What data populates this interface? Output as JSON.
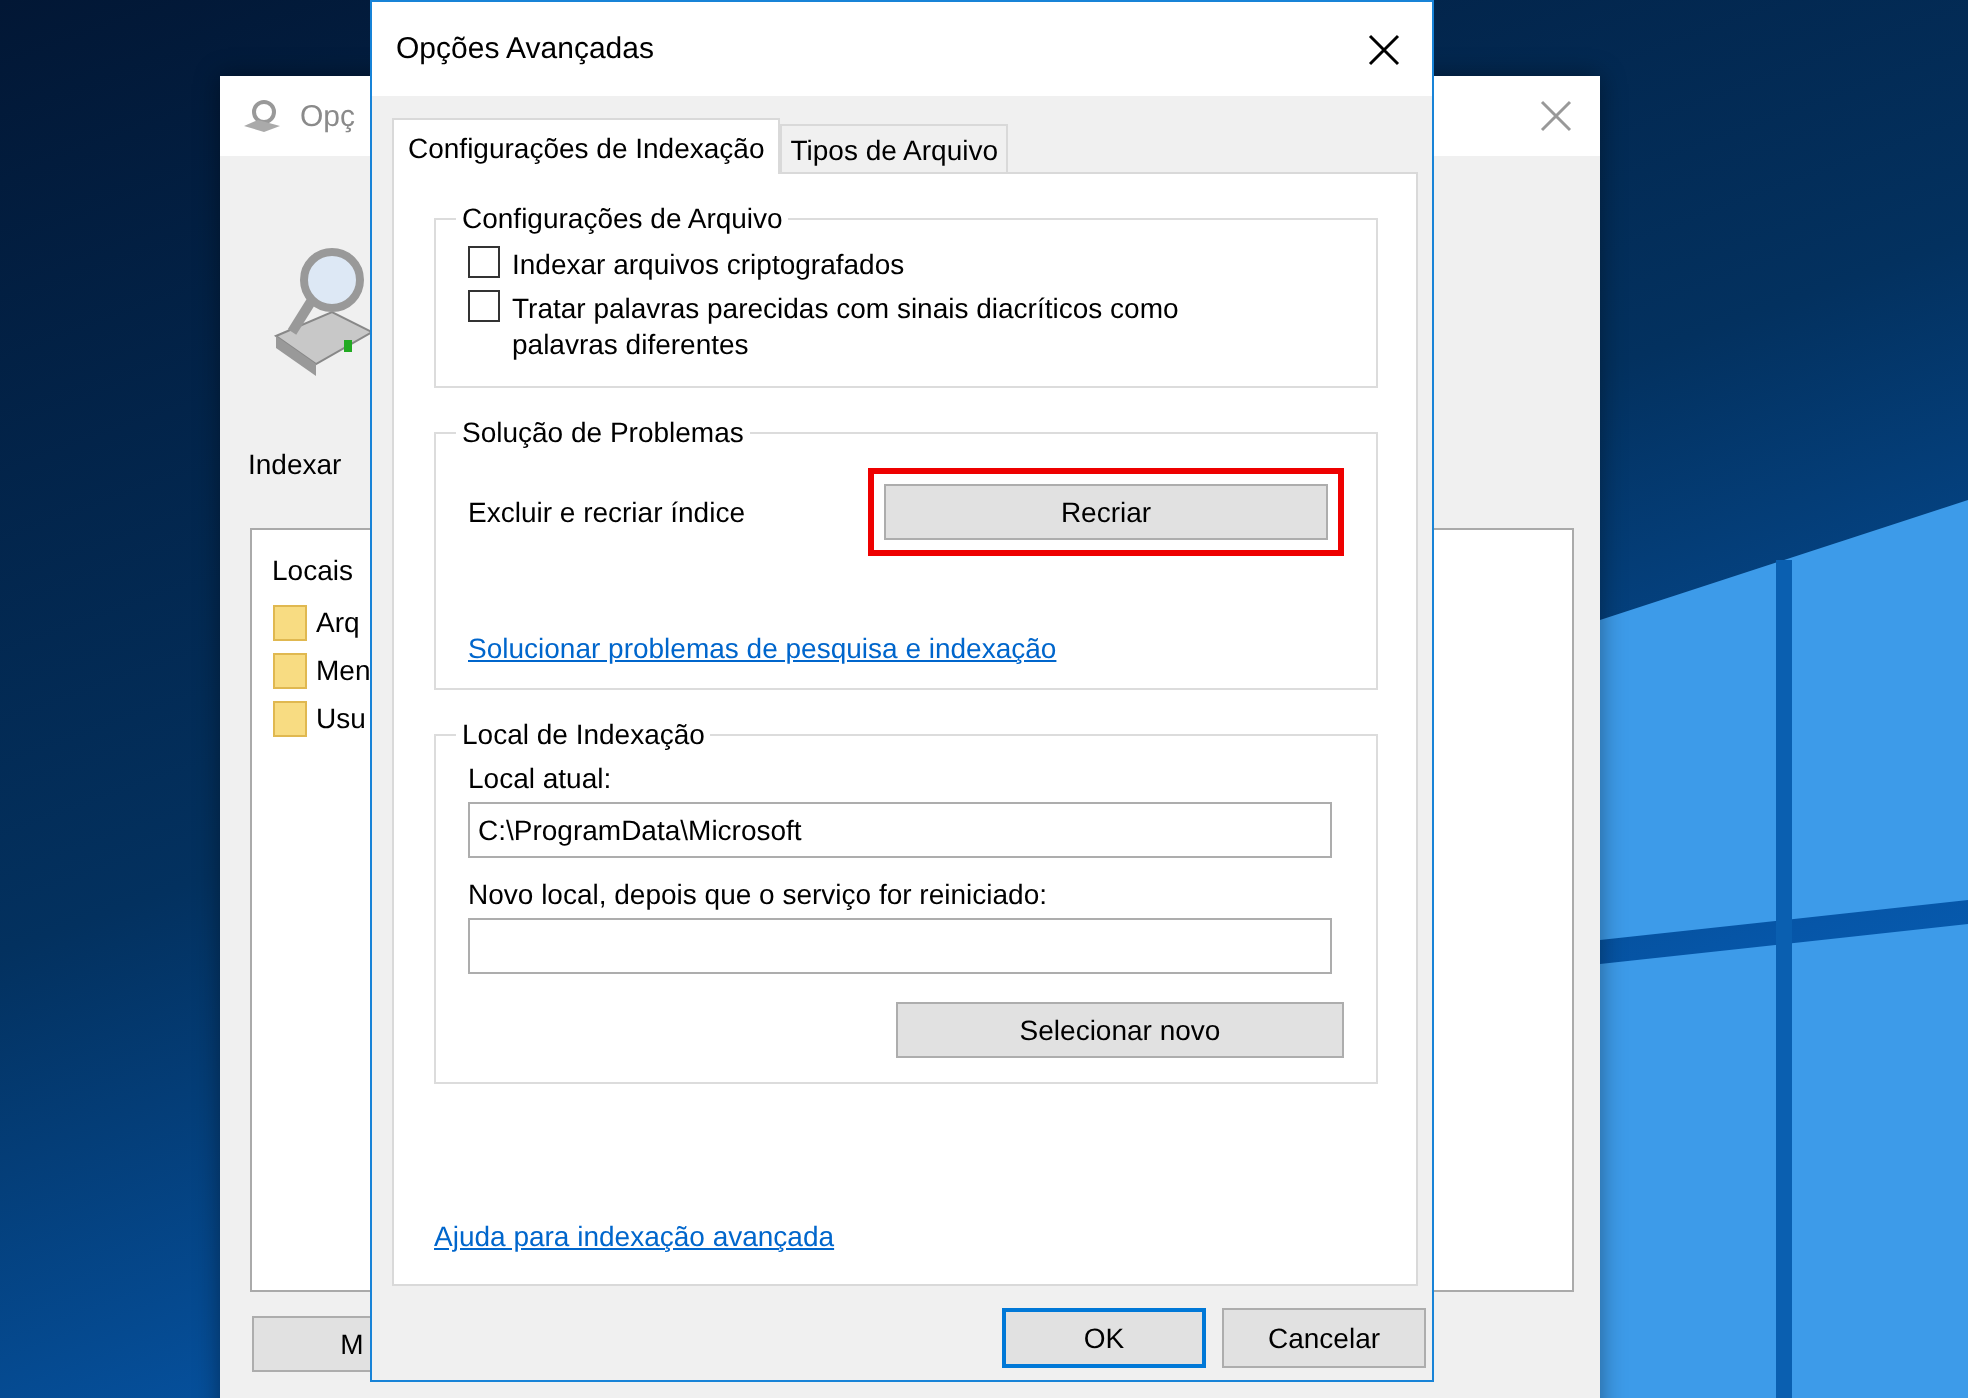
{
  "background_window": {
    "title": "Opç",
    "heading": "Indexar",
    "list_header": "Locais",
    "locations": [
      "Arq",
      "Men",
      "Usu"
    ],
    "button": "M"
  },
  "dialog": {
    "title": "Opções Avançadas",
    "tabs": [
      {
        "label": "Configurações de Indexação",
        "selected": true
      },
      {
        "label": "Tipos de Arquivo",
        "selected": false
      }
    ],
    "file_settings": {
      "title": "Configurações de Arquivo",
      "options": [
        {
          "label": "Indexar arquivos criptografados",
          "checked": false
        },
        {
          "label": "Tratar palavras parecidas com sinais diacríticos como palavras diferentes",
          "checked": false
        }
      ]
    },
    "troubleshooting": {
      "title": "Solução de Problemas",
      "rebuild_label": "Excluir e recriar índice",
      "rebuild_button": {
        "label": "Recriar",
        "highlighted": true
      },
      "link": "Solucionar problemas de pesquisa e indexação"
    },
    "index_location": {
      "title": "Local de Indexação",
      "current_label": "Local atual:",
      "current_value": "C:\\ProgramData\\Microsoft",
      "new_label": "Novo local, depois que o serviço for reiniciado:",
      "select_button": "Selecionar novo"
    },
    "help_link": "Ajuda para indexação avançada",
    "buttons": [
      {
        "label": "OK",
        "default": true
      },
      {
        "label": "Cancelar",
        "default": false
      }
    ]
  }
}
